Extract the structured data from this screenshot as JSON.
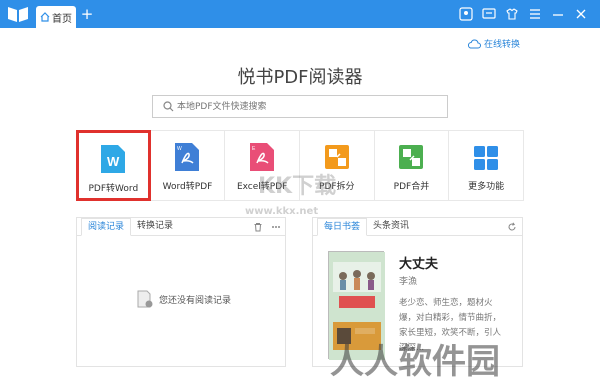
{
  "titlebar": {
    "tab_label": "首页",
    "tab_add": "+",
    "accent": "#2f8fe8"
  },
  "online_convert": "在线转换",
  "app_title": "悦书PDF阅读器",
  "search": {
    "placeholder": "本地PDF文件快速搜索"
  },
  "tools": [
    {
      "label": "PDF转Word",
      "icon": "pdf-to-word-icon",
      "color": "#2ea8e6",
      "selected": true
    },
    {
      "label": "Word转PDF",
      "icon": "word-to-pdf-icon",
      "color": "#3f7fd6"
    },
    {
      "label": "Excel转PDF",
      "icon": "excel-to-pdf-icon",
      "color": "#e94e77"
    },
    {
      "label": "PDF拆分",
      "icon": "pdf-split-icon",
      "color": "#f39a1c"
    },
    {
      "label": "PDF合并",
      "icon": "pdf-merge-icon",
      "color": "#4caf50"
    },
    {
      "label": "更多功能",
      "icon": "more-functions-icon",
      "color": "#2f8fe8"
    }
  ],
  "left_panel": {
    "tabs": [
      "阅读记录",
      "转换记录"
    ],
    "empty_text": "您还没有阅读记录"
  },
  "right_panel": {
    "tabs": [
      "每日书荟",
      "头条资讯"
    ],
    "book_title": "大丈夫",
    "book_author": "李漁",
    "book_desc": "老少恋、师生恋，题材火爆，对白精彩，情节曲折，家长里短，欢笑不断，引人深深..."
  },
  "watermarks": [
    "www.kkx.net",
    "KK下载",
    "人人软件园"
  ]
}
